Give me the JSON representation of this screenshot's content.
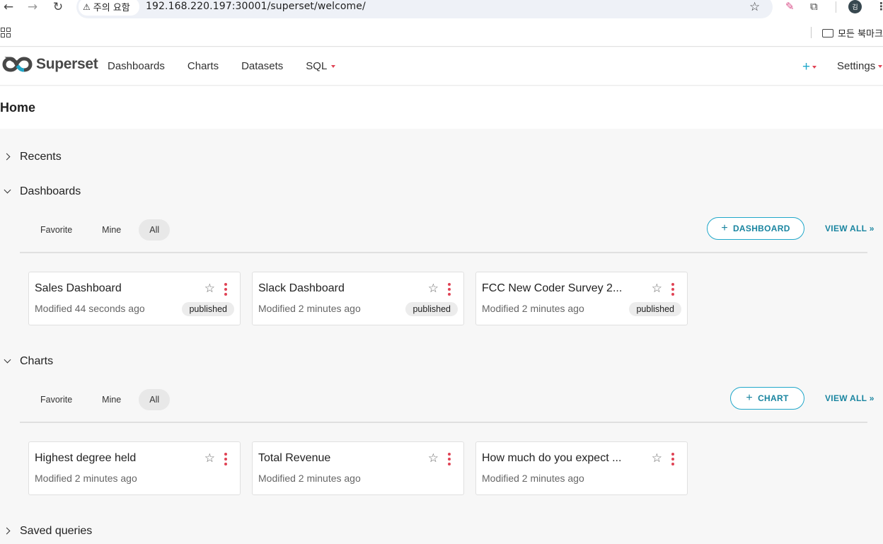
{
  "browser": {
    "back_icon": "back-arrow-icon",
    "security_label": "주의 요함",
    "url": "192.168.220.197:30001/superset/welcome/",
    "avatar_initial": "김",
    "bookmarks_folder": "모든 북마크"
  },
  "header": {
    "brand": "Superset",
    "nav": [
      "Dashboards",
      "Charts",
      "Datasets",
      "SQL"
    ],
    "plus_label": "+",
    "settings_label": "Settings"
  },
  "page": {
    "title": "Home"
  },
  "sections": {
    "recents": {
      "label": "Recents",
      "expanded": false
    },
    "dashboards": {
      "label": "Dashboards",
      "expanded": true,
      "tabs": [
        "Favorite",
        "Mine",
        "All"
      ],
      "active_tab": "All",
      "create_label": "DASHBOARD",
      "view_all": "VIEW ALL »",
      "cards": [
        {
          "title": "Sales Dashboard",
          "modified": "Modified 44 seconds ago",
          "status": "published"
        },
        {
          "title": "Slack Dashboard",
          "modified": "Modified 2 minutes ago",
          "status": "published"
        },
        {
          "title": "FCC New Coder Survey 2...",
          "modified": "Modified 2 minutes ago",
          "status": "published"
        }
      ]
    },
    "charts": {
      "label": "Charts",
      "expanded": true,
      "tabs": [
        "Favorite",
        "Mine",
        "All"
      ],
      "active_tab": "All",
      "create_label": "CHART",
      "view_all": "VIEW ALL »",
      "cards": [
        {
          "title": "Highest degree held",
          "modified": "Modified 2 minutes ago"
        },
        {
          "title": "Total Revenue",
          "modified": "Modified 2 minutes ago"
        },
        {
          "title": "How much do you expect ...",
          "modified": "Modified 2 minutes ago"
        }
      ]
    },
    "saved_queries": {
      "label": "Saved queries",
      "expanded": false
    }
  },
  "colors": {
    "accent": "#20a7c9",
    "accent_text": "#1a85a0",
    "kebab": "#e04355",
    "logo_dark": "#484848"
  }
}
